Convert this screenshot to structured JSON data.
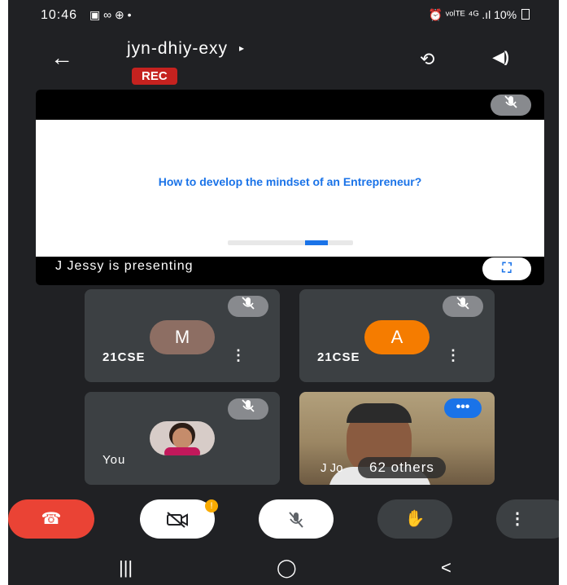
{
  "status_bar": {
    "time": "10:46",
    "left_icons": "▣ ∞ ⊕ •",
    "right_icons": "⏰ ᵛᵒˡᵀᴱ ⁴ᴳ .ıl",
    "battery": "10%"
  },
  "header": {
    "meeting_code": "jyn-dhiy-exy",
    "expand_glyph": "▸",
    "rec_label": "REC",
    "camera_switch_glyph": "⟲",
    "speaker_glyph": "◀)"
  },
  "presentation": {
    "slide_title": "How to develop the mindset of an Entrepreneur?",
    "presenter_text": "J Jessy is presenting",
    "fullscreen_glyph": "⛶"
  },
  "participants": [
    {
      "initial": "M",
      "name": "21CSE",
      "avatar_color": "#8d6e63"
    },
    {
      "initial": "A",
      "name": "21CSE",
      "avatar_color": "#f57c00"
    },
    {
      "name": "You"
    },
    {
      "name_partial": "J Jo",
      "others_label": "62 others"
    }
  ],
  "controls": {
    "end_call_glyph": "☎",
    "camera_badge": "!",
    "hand_glyph": "✋",
    "more_glyph": "⋮"
  },
  "nav": {
    "recents": "|||",
    "home": "◯",
    "back": "<"
  },
  "colors": {
    "background": "#202124",
    "tile": "#3c4043",
    "rec_red": "#c5221f",
    "end_call_red": "#ea4335",
    "accent_blue": "#1a73e8"
  }
}
